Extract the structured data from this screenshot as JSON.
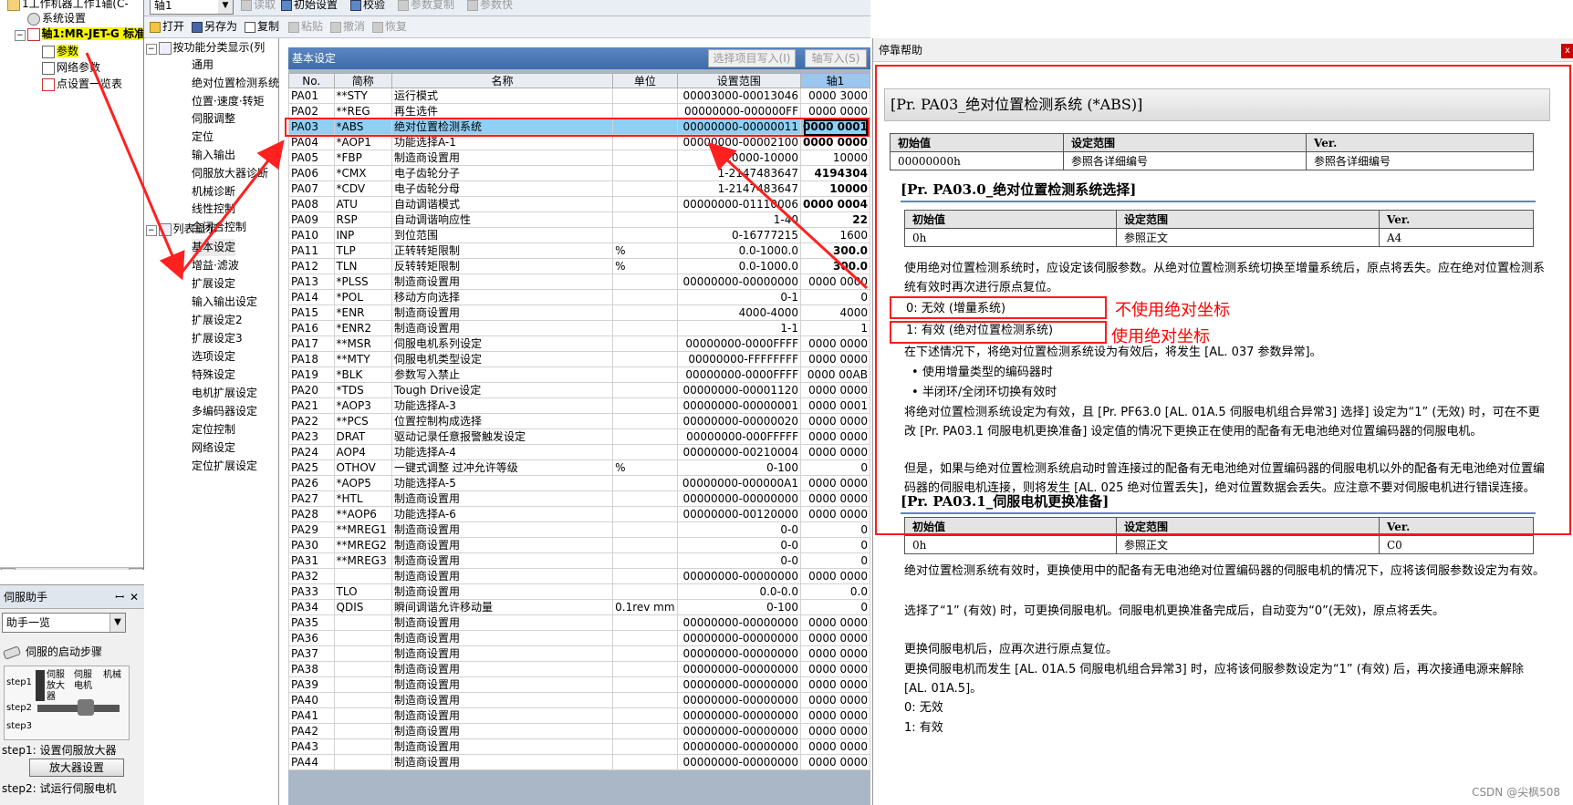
{
  "left_tree": {
    "items": [
      {
        "label": "1工作机器工作1轴(C-"
      },
      {
        "label": "系统设置"
      },
      {
        "label": "轴1:MR-JET-G 标准"
      },
      {
        "label": "参数"
      },
      {
        "label": "网络参数"
      },
      {
        "label": "点设置一览表"
      }
    ]
  },
  "helper": {
    "title": "伺服助手",
    "pin": "ꟷ",
    "close": "✕",
    "select_value": "助手一览",
    "startup_title": "伺服的启动步骤",
    "diagram": {
      "step1": "step1",
      "step2": "step2",
      "step3": "step3",
      "amp": "伺服放大器",
      "motor": "伺服电机",
      "machine": "机械"
    },
    "step1_text": "step1: 设置伺服放大器",
    "amp_button": "放大器设置",
    "step2_text": "step2: 试运行伺服电机"
  },
  "toolbar1": {
    "axis_select": "轴1",
    "read": "读取",
    "init": "初始设置",
    "verify": "校验",
    "param_copy": "参数复制",
    "param_list": "参数快"
  },
  "toolbar2": {
    "open": "打开",
    "save_as": "另存为",
    "copy": "复制",
    "paste": "粘贴",
    "undo": "撤消",
    "redo": "恢复"
  },
  "mid_tree": {
    "root1": "按功能分类显示(列",
    "group1": [
      "通用",
      "绝对位置检测系统",
      "位置·速度·转矩",
      "伺服调整",
      "定位",
      "输入输出",
      "伺服放大器诊断",
      "机械诊断",
      "线性控制",
      "全闭合控制"
    ],
    "root2": "列表显示",
    "group2": [
      "基本设定",
      "增益·滤波",
      "扩展设定",
      "输入输出设定",
      "扩展设定2",
      "扩展设定3",
      "选项设定",
      "特殊设定",
      "电机扩展设定",
      "多编码器设定",
      "定位控制",
      "网络设定",
      "定位扩展设定"
    ]
  },
  "grid": {
    "title": "基本设定",
    "btn_write": "选择项目写入(I)",
    "btn_axis": "轴写入(S)",
    "columns": [
      "No.",
      "简称",
      "名称",
      "单位",
      "设置范围",
      "轴1"
    ],
    "rows": [
      [
        "PA01",
        "**STY",
        "运行模式",
        "",
        "00003000-00013046",
        "0000 3000"
      ],
      [
        "PA02",
        "**REG",
        "再生选件",
        "",
        "00000000-000000FF",
        "0000 0000"
      ],
      [
        "PA03",
        "*ABS",
        "绝对位置检测系统",
        "",
        "00000000-00000011",
        "0000 0001"
      ],
      [
        "PA04",
        "*AOP1",
        "功能选择A-1",
        "",
        "00000000-00002100",
        "0000 0000"
      ],
      [
        "PA05",
        "*FBP",
        "制造商设置用",
        "",
        "10000-10000",
        "10000"
      ],
      [
        "PA06",
        "*CMX",
        "电子齿轮分子",
        "",
        "1-2147483647",
        "4194304"
      ],
      [
        "PA07",
        "*CDV",
        "电子齿轮分母",
        "",
        "1-2147483647",
        "10000"
      ],
      [
        "PA08",
        "ATU",
        "自动调谐模式",
        "",
        "00000000-01110006",
        "0000 0004"
      ],
      [
        "PA09",
        "RSP",
        "自动调谐响应性",
        "",
        "1-40",
        "22"
      ],
      [
        "PA10",
        "INP",
        "到位范围",
        "",
        "0-16777215",
        "1600"
      ],
      [
        "PA11",
        "TLP",
        "正转转矩限制",
        "%",
        "0.0-1000.0",
        "300.0"
      ],
      [
        "PA12",
        "TLN",
        "反转转矩限制",
        "%",
        "0.0-1000.0",
        "300.0"
      ],
      [
        "PA13",
        "*PLSS",
        "制造商设置用",
        "",
        "00000000-00000000",
        "0000 0000"
      ],
      [
        "PA14",
        "*POL",
        "移动方向选择",
        "",
        "0-1",
        "0"
      ],
      [
        "PA15",
        "*ENR",
        "制造商设置用",
        "",
        "4000-4000",
        "4000"
      ],
      [
        "PA16",
        "*ENR2",
        "制造商设置用",
        "",
        "1-1",
        "1"
      ],
      [
        "PA17",
        "**MSR",
        "伺服电机系列设定",
        "",
        "00000000-0000FFFF",
        "0000 0000"
      ],
      [
        "PA18",
        "**MTY",
        "伺服电机类型设定",
        "",
        "00000000-FFFFFFFF",
        "0000 0000"
      ],
      [
        "PA19",
        "*BLK",
        "参数写入禁止",
        "",
        "00000000-0000FFFF",
        "0000 00AB"
      ],
      [
        "PA20",
        "*TDS",
        "Tough Drive设定",
        "",
        "00000000-00001120",
        "0000 0000"
      ],
      [
        "PA21",
        "*AOP3",
        "功能选择A-3",
        "",
        "00000000-00000001",
        "0000 0001"
      ],
      [
        "PA22",
        "**PCS",
        "位置控制构成选择",
        "",
        "00000000-00000020",
        "0000 0000"
      ],
      [
        "PA23",
        "DRAT",
        "驱动记录任意报警触发设定",
        "",
        "00000000-000FFFFF",
        "0000 0000"
      ],
      [
        "PA24",
        "AOP4",
        "功能选择A-4",
        "",
        "00000000-00210004",
        "0000 0000"
      ],
      [
        "PA25",
        "OTHOV",
        "一键式调整 过冲允许等级",
        "%",
        "0-100",
        "0"
      ],
      [
        "PA26",
        "*AOP5",
        "功能选择A-5",
        "",
        "00000000-000000A1",
        "0000 0000"
      ],
      [
        "PA27",
        "*HTL",
        "制造商设置用",
        "",
        "00000000-00000000",
        "0000 0000"
      ],
      [
        "PA28",
        "**AOP6",
        "功能选择A-6",
        "",
        "00000000-00120000",
        "0000 0000"
      ],
      [
        "PA29",
        "**MREG1",
        "制造商设置用",
        "",
        "0-0",
        "0"
      ],
      [
        "PA30",
        "**MREG2",
        "制造商设置用",
        "",
        "0-0",
        "0"
      ],
      [
        "PA31",
        "**MREG3",
        "制造商设置用",
        "",
        "0-0",
        "0"
      ],
      [
        "PA32",
        "",
        "制造商设置用",
        "",
        "00000000-00000000",
        "0000 0000"
      ],
      [
        "PA33",
        "TLO",
        "制造商设置用",
        "",
        "0.0-0.0",
        "0.0"
      ],
      [
        "PA34",
        "QDIS",
        "瞬间调谐允许移动量",
        "0.1rev mm",
        "0-100",
        "0"
      ],
      [
        "PA35",
        "",
        "制造商设置用",
        "",
        "00000000-00000000",
        "0000 0000"
      ],
      [
        "PA36",
        "",
        "制造商设置用",
        "",
        "00000000-00000000",
        "0000 0000"
      ],
      [
        "PA37",
        "",
        "制造商设置用",
        "",
        "00000000-00000000",
        "0000 0000"
      ],
      [
        "PA38",
        "",
        "制造商设置用",
        "",
        "00000000-00000000",
        "0000 0000"
      ],
      [
        "PA39",
        "",
        "制造商设置用",
        "",
        "00000000-00000000",
        "0000 0000"
      ],
      [
        "PA40",
        "",
        "制造商设置用",
        "",
        "00000000-00000000",
        "0000 0000"
      ],
      [
        "PA41",
        "",
        "制造商设置用",
        "",
        "00000000-00000000",
        "0000 0000"
      ],
      [
        "PA42",
        "",
        "制造商设置用",
        "",
        "00000000-00000000",
        "0000 0000"
      ],
      [
        "PA43",
        "",
        "制造商设置用",
        "",
        "00000000-00000000",
        "0000 0000"
      ],
      [
        "PA44",
        "",
        "制造商设置用",
        "",
        "00000000-00000000",
        "0000 0000"
      ]
    ]
  },
  "help": {
    "title": "停靠帮助",
    "close": "x",
    "heading": "[Pr. PA03_绝对位置检测系统 (*ABS)]",
    "t1": {
      "h": [
        "初始值",
        "设定范围",
        "Ver."
      ],
      "r": [
        "00000000h",
        "参照各详细编号",
        "参照各详细编号"
      ]
    },
    "sub1": "[Pr. PA03.0_绝对位置检测系统选择]",
    "t2": {
      "h": [
        "初始值",
        "设定范围",
        "Ver."
      ],
      "r": [
        "0h",
        "参照正文",
        "A4"
      ]
    },
    "p1": "使用绝对位置检测系统时，应设定该伺服参数。从绝对位置检测系统切换至增量系统后，原点将丢失。应在绝对位置检测系统有效时再次进行原点复位。",
    "opt0": "0: 无效 (增量系统)",
    "opt1": "1: 有效 (绝对位置检测系统)",
    "ann0": "不使用绝对坐标",
    "ann1": "使用绝对坐标",
    "p2": "在下述情况下，将绝对位置检测系统设为有效后，将发生 [AL. 037 参数异常]。",
    "b1": "使用增量类型的编码器时",
    "b2": "半闭环/全闭环切换有效时",
    "p3": "将绝对位置检测系统设定为有效，且 [Pr. PF63.0 [AL. 01A.5 伺服电机组合异常3] 选择] 设定为“1” (无效) 时，可在不更改 [Pr. PA03.1 伺服电机更换准备] 设定值的情况下更换正在使用的配备有无电池绝对位置编码器的伺服电机。",
    "p4": "但是，如果与绝对位置检测系统启动时曾连接过的配备有无电池绝对位置编码器的伺服电机以外的配备有无电池绝对位置编码器的伺服电机连接，则将发生 [AL. 025 绝对位置丢失]，绝对位置数据会丢失。应注意不要对伺服电机进行错误连接。",
    "sub2": "[Pr. PA03.1_伺服电机更换准备]",
    "t3": {
      "h": [
        "初始值",
        "设定范围",
        "Ver."
      ],
      "r": [
        "0h",
        "参照正文",
        "C0"
      ]
    },
    "p5": "绝对位置检测系统有效时，更换使用中的配备有无电池绝对位置编码器的伺服电机的情况下，应将该伺服参数设定为有效。",
    "p6": "选择了“1” (有效) 时，可更换伺服电机。伺服电机更换准备完成后，自动变为“0”(无效)，原点将丢失。",
    "p7": "更换伺服电机后，应再次进行原点复位。",
    "p8": "更换伺服电机而发生 [AL. 01A.5 伺服电机组合异常3] 时，应将该伺服参数设定为“1” (有效) 后，再次接通电源来解除 [AL. 01A.5]。",
    "p9": "0: 无效",
    "p10": "1: 有效"
  },
  "watermark": "CSDN @尖枫508",
  "colors": {
    "accent": "#3e6aa9",
    "selection": "#8fd0f5",
    "annotation": "#ff0000",
    "highlight": "#f5f500"
  }
}
